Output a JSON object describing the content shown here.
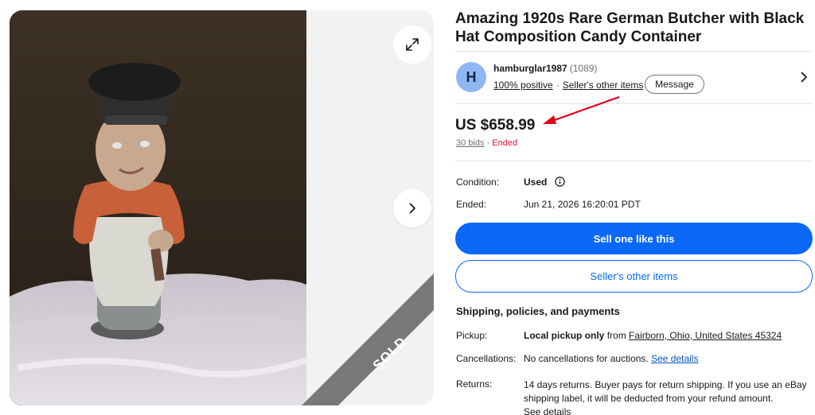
{
  "listing": {
    "title": "Amazing 1920s Rare German Butcher with Black Hat Composition Candy Container",
    "sold_label": "SOLD"
  },
  "seller": {
    "initial": "H",
    "name": "hamburglar1987",
    "feedback_count": "(1089)",
    "positive": "100% positive",
    "other_items": "Seller's other items",
    "message_label": "Message"
  },
  "price": {
    "amount": "US $658.99",
    "bids": "30 bids",
    "separator": "·",
    "status": "Ended"
  },
  "details": {
    "condition_label": "Condition:",
    "condition_value": "Used",
    "ended_label": "Ended:",
    "ended_value": "Jun 21, 2026 16:20:01 PDT"
  },
  "actions": {
    "sell_label": "Sell one like this",
    "other_items_label": "Seller's other items"
  },
  "shipping": {
    "section_title": "Shipping, policies, and payments",
    "pickup_label": "Pickup:",
    "pickup_bold": "Local pickup only",
    "pickup_from": "from",
    "pickup_location": "Fairborn, Ohio, United States 45324",
    "cancellations_label": "Cancellations:",
    "cancellations_text": "No cancellations for auctions.",
    "see_details": "See details",
    "returns_label": "Returns:",
    "returns_text": "14 days returns. Buyer pays for return shipping. If you use an eBay shipping label, it will be deducted from your refund amount.",
    "returns_see_details": "See details"
  },
  "colors": {
    "primary_blue": "#0968f6",
    "ended_red": "#e0103a",
    "annotation_arrow": "#e3001b"
  },
  "icons": [
    "expand-icon",
    "chevron-right-icon",
    "info-icon",
    "annotation-arrow"
  ]
}
